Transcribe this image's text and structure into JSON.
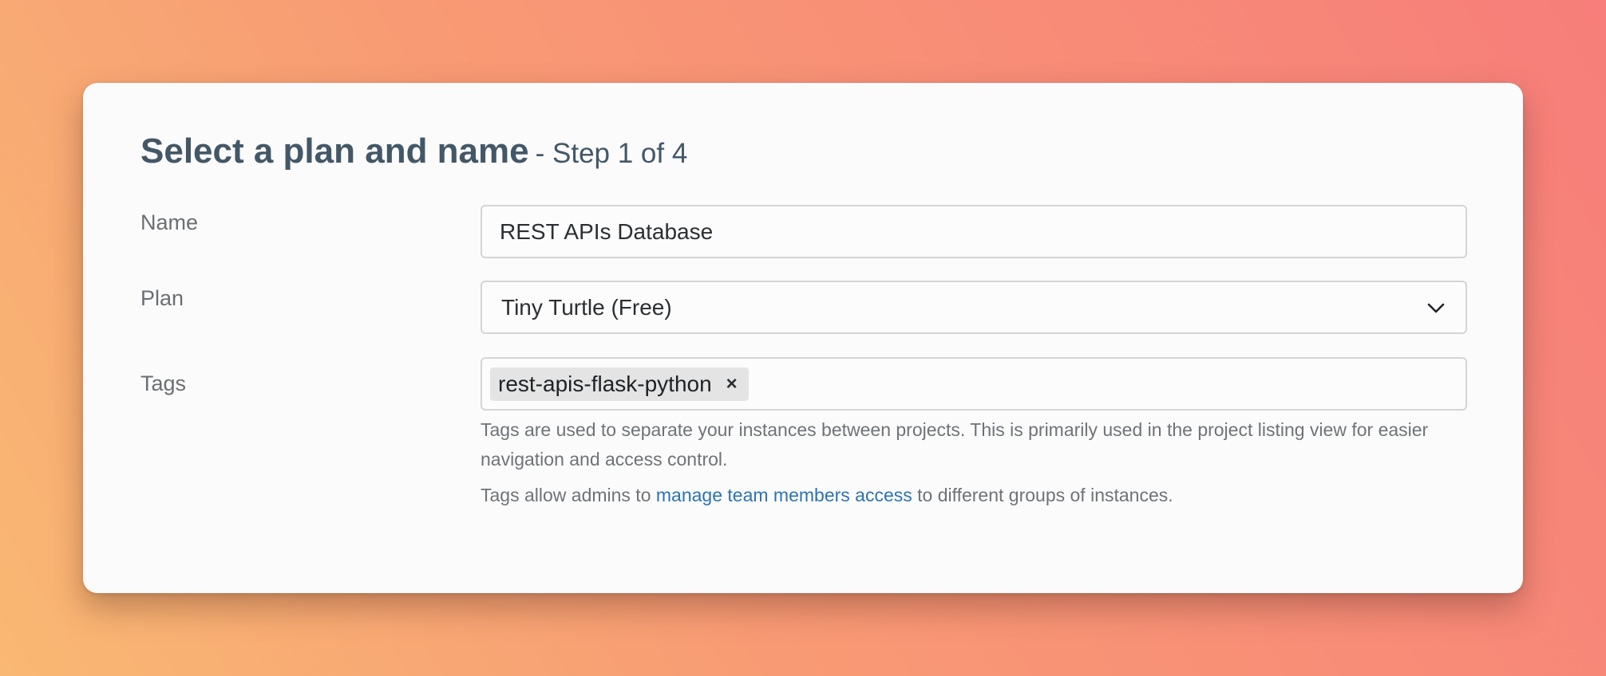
{
  "header": {
    "title": "Select a plan and name",
    "step": "- Step 1 of 4"
  },
  "form": {
    "name": {
      "label": "Name",
      "value": "REST APIs Database"
    },
    "plan": {
      "label": "Plan",
      "selected": "Tiny Turtle (Free)",
      "icon": "chevron-down-icon"
    },
    "tags": {
      "label": "Tags",
      "chips": [
        {
          "text": "rest-apis-flask-python",
          "remove": "×"
        }
      ],
      "help_text": "Tags are used to separate your instances between projects. This is primarily used in the project listing view for easier navigation and access control.",
      "access_before": "Tags allow admins to ",
      "access_link": "manage team members access",
      "access_after": " to different groups of instances."
    }
  },
  "colors": {
    "title": "#435767",
    "link": "#2c73b4",
    "chip_bg": "#e4e4e4"
  }
}
